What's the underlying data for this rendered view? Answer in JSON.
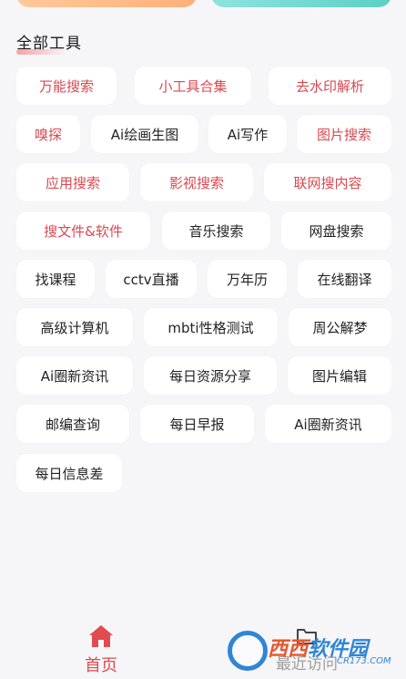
{
  "section": {
    "title": "全部工具"
  },
  "tools": [
    "万能搜索",
    "小工具合集",
    "去水印解析",
    "嗅探",
    "Ai绘画生图",
    "Ai写作",
    "图片搜索",
    "应用搜索",
    "影视搜索",
    "联网搜内容",
    "搜文件&软件",
    "音乐搜索",
    "网盘搜索",
    "找课程",
    "cctv直播",
    "万年历",
    "在线翻译",
    "高级计算机",
    "mbti性格测试",
    "周公解梦",
    "Ai圈新资讯",
    "每日资源分享",
    "图片编辑",
    "邮编查询",
    "每日早报",
    "Ai圈新资讯",
    "每日信息差"
  ],
  "nav": {
    "home": "首页",
    "recent": "最近访问"
  },
  "watermark": {
    "brand_a": "西西",
    "brand_b": "软件园",
    "domain": "CR173.COM"
  },
  "colors": {
    "accent": "#e24b4f",
    "chip_red_text": "#d84a50"
  }
}
